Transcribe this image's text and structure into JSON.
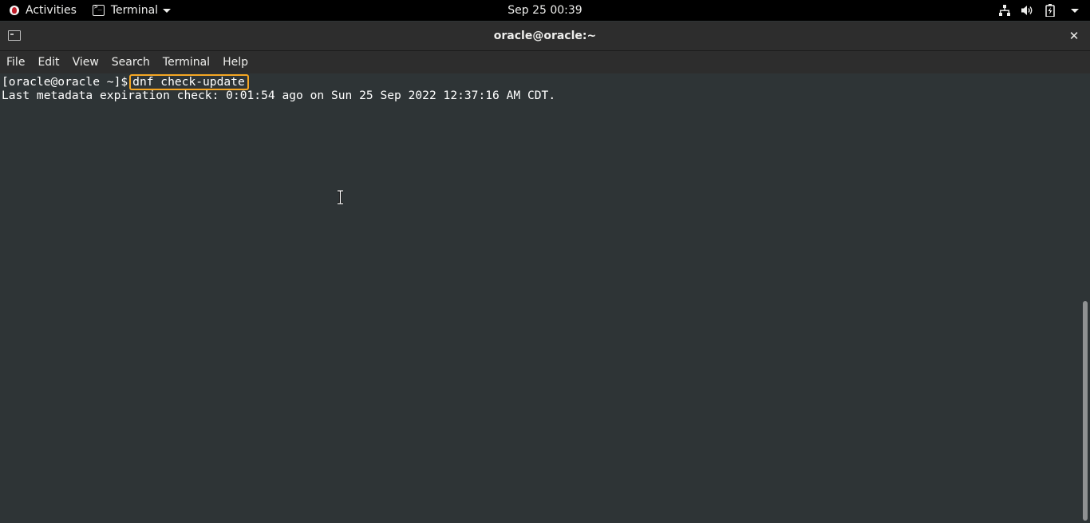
{
  "topbar": {
    "activities_label": "Activities",
    "app_menu_label": "Terminal",
    "clock": "Sep 25  00:39"
  },
  "window": {
    "title": "oracle@oracle:~",
    "close_glyph": "✕"
  },
  "menubar": {
    "items": [
      "File",
      "Edit",
      "View",
      "Search",
      "Terminal",
      "Help"
    ]
  },
  "terminal": {
    "prompt": "[oracle@oracle ~]$",
    "command": "dnf check-update",
    "output": "Last metadata expiration check: 0:01:54 ago on Sun 25 Sep 2022 12:37:16 AM CDT."
  },
  "colors": {
    "highlight": "#f5a623",
    "terminal_bg": "#2e3436",
    "topbar_bg": "#000000"
  },
  "icons": [
    "activities-icon",
    "terminal-app-icon",
    "caret-down-icon",
    "network-icon",
    "volume-icon",
    "battery-icon",
    "system-menu-caret-icon",
    "terminal-window-icon",
    "close-icon",
    "text-cursor-icon"
  ]
}
